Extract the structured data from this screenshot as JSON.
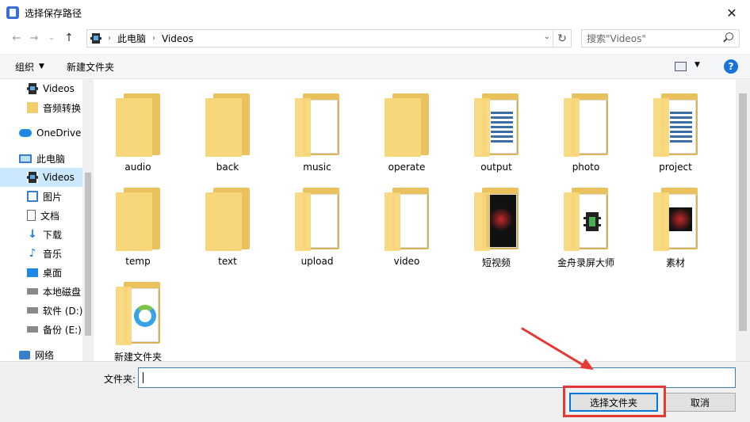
{
  "window": {
    "title": "选择保存路径",
    "close_glyph": "✕"
  },
  "address": {
    "crumbs": [
      "此电脑",
      "Videos"
    ],
    "separator": "›",
    "dropdown_glyph": "⌄",
    "refresh_glyph": "↻",
    "search_placeholder": "搜索\"Videos\""
  },
  "nav": {
    "back_glyph": "←",
    "forward_glyph": "→",
    "recent_glyph": "⌄",
    "up_glyph": "↑"
  },
  "toolbar": {
    "organize_label": "组织",
    "organize_caret": "▼",
    "new_folder_label": "新建文件夹",
    "view_caret": "▼",
    "help_label": "?"
  },
  "sidebar": {
    "items": [
      {
        "label": "Videos",
        "icon": "film-icon"
      },
      {
        "label": "音频转换",
        "icon": "folder-icon"
      },
      {
        "label": "OneDrive",
        "icon": "cloud-icon"
      },
      {
        "label": "此电脑",
        "icon": "pc-icon"
      },
      {
        "label": "Videos",
        "icon": "film-icon",
        "selected": true
      },
      {
        "label": "图片",
        "icon": "pictures-icon"
      },
      {
        "label": "文档",
        "icon": "documents-icon"
      },
      {
        "label": "下载",
        "icon": "download-icon"
      },
      {
        "label": "音乐",
        "icon": "music-icon"
      },
      {
        "label": "桌面",
        "icon": "desktop-icon"
      },
      {
        "label": "本地磁盘",
        "icon": "disk-icon"
      },
      {
        "label": "软件 (D:)",
        "icon": "disk-icon"
      },
      {
        "label": "备份 (E:)",
        "icon": "disk-icon"
      },
      {
        "label": "网络",
        "icon": "network-icon"
      }
    ],
    "download_glyph": "↓",
    "music_glyph": "♪"
  },
  "files": [
    {
      "name": "audio",
      "thumb": "plain"
    },
    {
      "name": "back",
      "thumb": "plain"
    },
    {
      "name": "music",
      "thumb": "paper"
    },
    {
      "name": "operate",
      "thumb": "plain"
    },
    {
      "name": "output",
      "thumb": "stripes"
    },
    {
      "name": "photo",
      "thumb": "paper"
    },
    {
      "name": "project",
      "thumb": "stripes"
    },
    {
      "name": "temp",
      "thumb": "plain"
    },
    {
      "name": "text",
      "thumb": "plain"
    },
    {
      "name": "upload",
      "thumb": "paper"
    },
    {
      "name": "video",
      "thumb": "paper"
    },
    {
      "name": "短视频",
      "thumb": "dark"
    },
    {
      "name": "金舟录屏大师",
      "thumb": "film"
    },
    {
      "name": "素材",
      "thumb": "red"
    },
    {
      "name": "新建文件夹",
      "thumb": "logo"
    }
  ],
  "bottom": {
    "folder_label": "文件夹:",
    "folder_value": "",
    "select_button": "选择文件夹",
    "cancel_button": "取消"
  },
  "annotation_color": "#e53935",
  "accent_color": "#0078d7"
}
